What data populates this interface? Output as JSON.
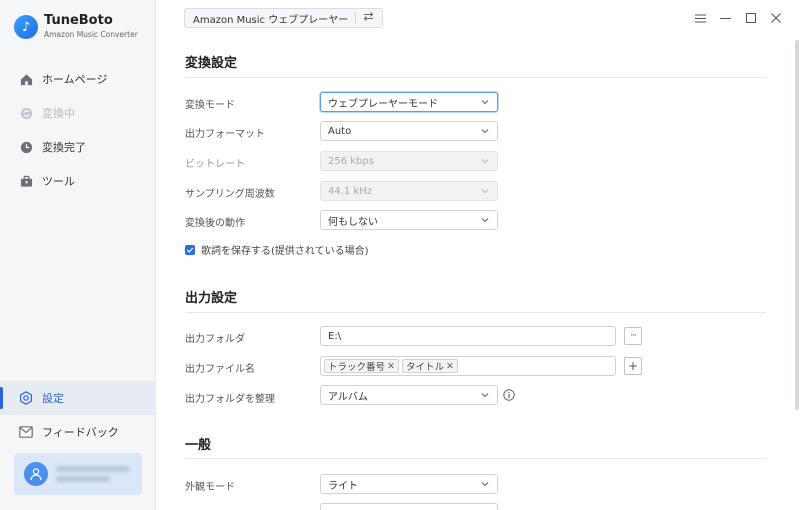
{
  "brand": {
    "name": "TuneBoto",
    "subtitle": "Amazon Music Converter"
  },
  "sidebar": {
    "items": [
      {
        "label": "ホームページ",
        "icon": "home-icon",
        "state": "normal"
      },
      {
        "label": "変換中",
        "icon": "sync-icon",
        "state": "disabled"
      },
      {
        "label": "変換完了",
        "icon": "clock-icon",
        "state": "normal"
      },
      {
        "label": "ツール",
        "icon": "toolbox-icon",
        "state": "normal"
      }
    ],
    "bottom_items": [
      {
        "label": "設定",
        "icon": "settings-icon",
        "state": "active"
      },
      {
        "label": "フィードバック",
        "icon": "mail-icon",
        "state": "normal"
      }
    ]
  },
  "topbar": {
    "source_label": "Amazon Music ウェブプレーヤー",
    "swap_icon": "swap-icon"
  },
  "sections": {
    "conversion": {
      "title": "変換設定",
      "mode_label": "変換モード",
      "mode_value": "ウェブプレーヤーモード",
      "format_label": "出力フォーマット",
      "format_value": "Auto",
      "bitrate_label": "ビットレート",
      "bitrate_value": "256 kbps",
      "samplerate_label": "サンプリング周波数",
      "samplerate_value": "44.1 kHz",
      "after_label": "変換後の動作",
      "after_value": "何もしない",
      "lyrics_label": "歌詞を保存する(提供されている場合)",
      "lyrics_checked": true
    },
    "output": {
      "title": "出力設定",
      "folder_label": "出力フォルダ",
      "folder_value": "E:\\",
      "browse_label": "···",
      "filename_label": "出力ファイル名",
      "filename_tags": [
        "トラック番号",
        "タイトル"
      ],
      "add_label": "+",
      "organize_label": "出力フォルダを整理",
      "organize_value": "アルバム"
    },
    "general": {
      "title": "一般",
      "appearance_label": "外観モード",
      "appearance_value": "ライト"
    }
  },
  "colors": {
    "accent": "#2b66d8",
    "sidebar_bg": "#f5f6f8"
  }
}
